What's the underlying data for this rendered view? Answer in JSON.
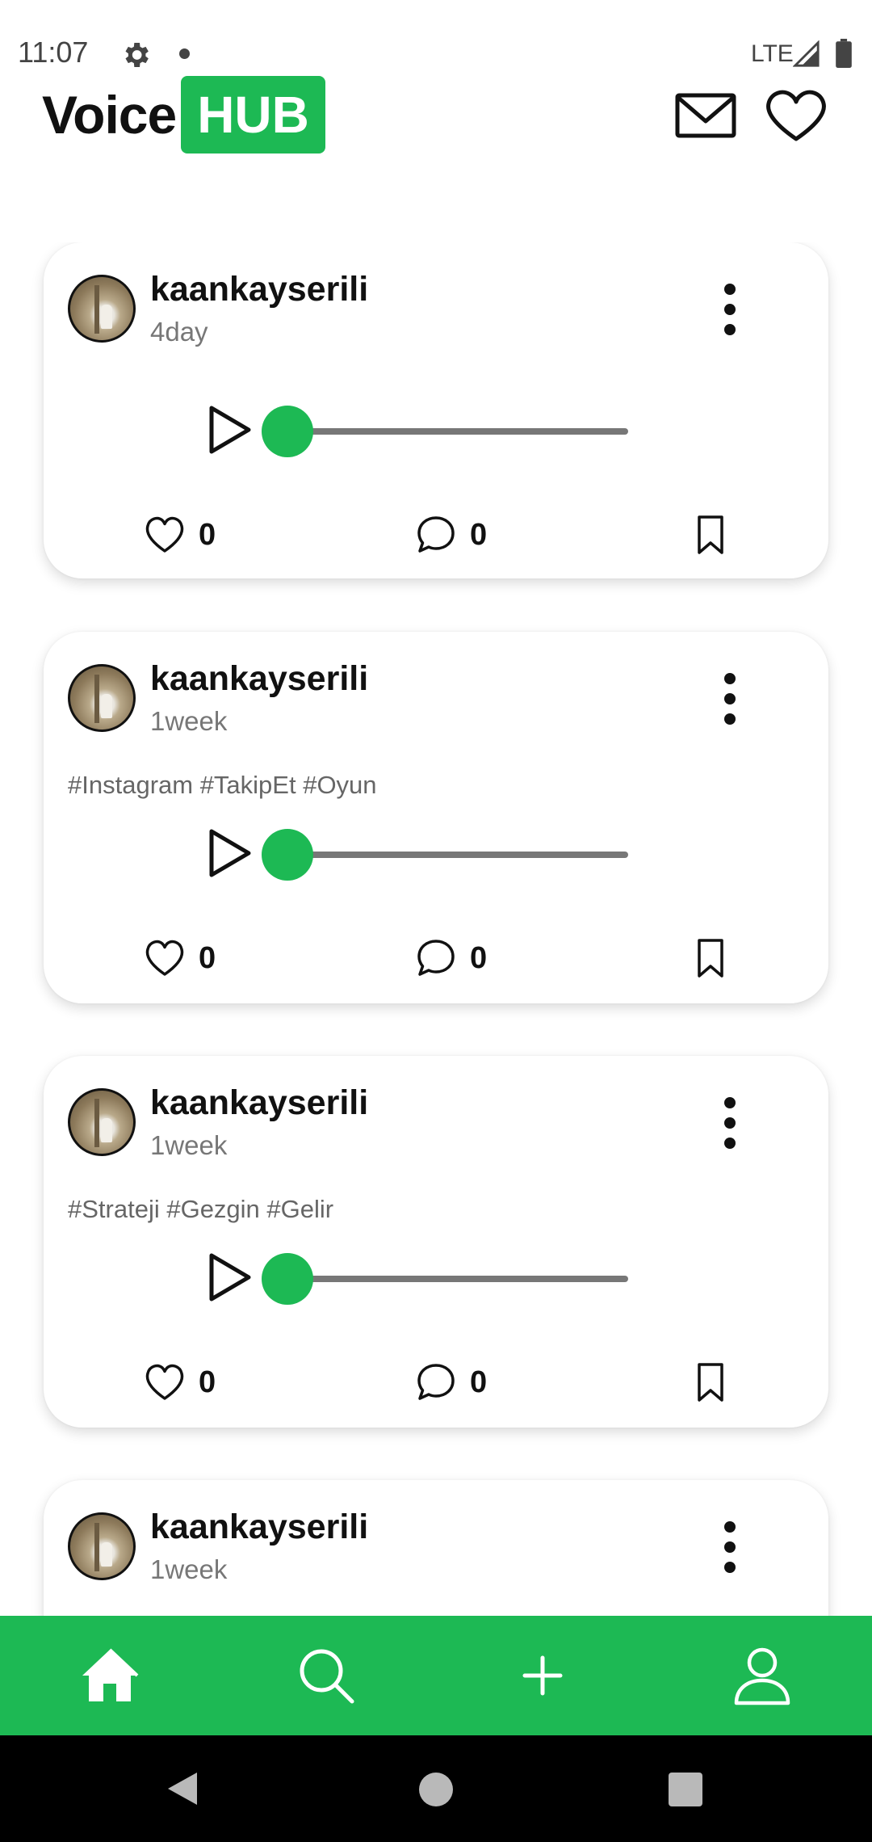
{
  "status_bar": {
    "time": "11:07",
    "network": "LTE",
    "icons": [
      "gear-icon",
      "notification-dot-icon",
      "signal-icon",
      "battery-icon"
    ]
  },
  "header": {
    "logo_part1": "Voice",
    "logo_part2": "HUB",
    "icons": [
      "mail-icon",
      "heart-icon"
    ]
  },
  "colors": {
    "brand_green": "#1db954",
    "text": "#111111",
    "muted": "#777777",
    "track": "#777777"
  },
  "posts": [
    {
      "username": "kaankayserili",
      "time": "4day",
      "hashtags": "",
      "likes": "0",
      "comments": "0",
      "progress": 0
    },
    {
      "username": "kaankayserili",
      "time": "1week",
      "hashtags": "#Instagram #TakipEt #Oyun",
      "likes": "0",
      "comments": "0",
      "progress": 0
    },
    {
      "username": "kaankayserili",
      "time": "1week",
      "hashtags": "#Strateji #Gezgin #Gelir",
      "likes": "0",
      "comments": "0",
      "progress": 0
    },
    {
      "username": "kaankayserili",
      "time": "1week"
    }
  ],
  "bottom_nav": {
    "items": [
      "home-icon",
      "search-icon",
      "add-icon",
      "profile-icon"
    ],
    "active": "home-icon"
  },
  "system_nav": {
    "items": [
      "back-icon",
      "home-circle-icon",
      "recents-icon"
    ]
  }
}
